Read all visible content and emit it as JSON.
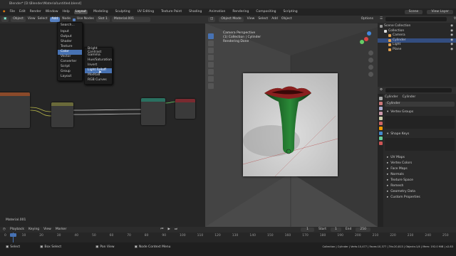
{
  "window_title": "Blender* [D:\\Blender\\Material\\untitled.blend]",
  "topbar": {
    "menus": [
      "File",
      "Edit",
      "Render",
      "Window",
      "Help"
    ],
    "workspaces": [
      "Layout",
      "Modeling",
      "Sculpting",
      "UV Editing",
      "Texture Paint",
      "Shading",
      "Animation",
      "Rendering",
      "Compositing",
      "Scripting"
    ],
    "active_workspace": "Layout",
    "scene": "Scene",
    "view_layer": "View Layer"
  },
  "node_editor": {
    "header": {
      "editor": "Object",
      "menus": [
        "View",
        "Select",
        "Add",
        "Node"
      ],
      "use_nodes_label": "Use Nodes",
      "slot": "Slot 1",
      "material": "Material.001"
    },
    "add_menu": {
      "search_label": "Search...",
      "items": [
        "Input",
        "Output",
        "Shader",
        "Texture",
        "Color",
        "Vector",
        "Converter",
        "Script",
        "Group",
        "Layout"
      ],
      "highlighted": "Color"
    },
    "color_submenu": {
      "items": [
        "Bright Contrast",
        "Gamma",
        "Hue/Saturation",
        "Invert",
        "Light Falloff",
        "MixRGB",
        "RGB Curves"
      ],
      "highlighted": "Light Falloff"
    },
    "material_name": "Material.001"
  },
  "viewport": {
    "header": {
      "mode": "Object Mode",
      "menus": [
        "View",
        "Select",
        "Add",
        "Object"
      ],
      "options": "Options"
    },
    "overlay_text": [
      "Camera Perspective",
      "(1) Collection | Cylinder",
      "Rendering Done"
    ]
  },
  "outliner": {
    "rows": [
      {
        "label": "Scene Collection",
        "indent": 0,
        "selected": false,
        "icon_color": "#9a9a9a"
      },
      {
        "label": "Collection",
        "indent": 1,
        "selected": false,
        "icon_color": "#dddddd"
      },
      {
        "label": "Camera",
        "indent": 2,
        "selected": false,
        "icon_color": "#e0a050"
      },
      {
        "label": "Cylinder",
        "indent": 2,
        "selected": true,
        "icon_color": "#e0a050"
      },
      {
        "label": "Light",
        "indent": 2,
        "selected": false,
        "icon_color": "#e0a050"
      },
      {
        "label": "Plane",
        "indent": 2,
        "selected": false,
        "icon_color": "#e0a050"
      }
    ]
  },
  "properties": {
    "object_name": "Cylinder",
    "data_name": "Cylinder",
    "mesh_name": "Cylinder",
    "panels_top": [
      "Vertex Groups",
      "Shape Keys"
    ],
    "panels_bottom": [
      "UV Maps",
      "Vertex Colors",
      "Face Maps",
      "Normals",
      "Texture Space",
      "Remesh",
      "Geometry Data",
      "Custom Properties"
    ]
  },
  "timeline": {
    "menus": [
      "Playback",
      "Keying",
      "View",
      "Marker"
    ],
    "ticks": [
      "0",
      "10",
      "20",
      "30",
      "40",
      "50",
      "60",
      "70",
      "80",
      "90",
      "100",
      "110",
      "120",
      "130",
      "140",
      "150",
      "160",
      "170",
      "180",
      "190",
      "200",
      "210",
      "220",
      "230",
      "240",
      "250"
    ],
    "current_frame": "1",
    "start_label": "Start",
    "start": "1",
    "end_label": "End",
    "end": "250"
  },
  "statusbar": {
    "left": [
      "Select",
      "Box Select",
      "Pan View",
      "Node Context Menu"
    ],
    "right": "Collection | Cylinder | Verts:10,477 | Faces:10,377 | Tris:20,813 | Objects:1/4 | Mem: 192.0 MiB | v2.83"
  },
  "colors": {
    "accent": "#4772b3",
    "selection": "#334d80",
    "vase_top": "#8a1f1f",
    "vase_body": "#1f6b2a",
    "node_texture_header": "#8a4a2a",
    "node_shader_header": "#2a7060",
    "node_output_header": "#7a2a30"
  }
}
